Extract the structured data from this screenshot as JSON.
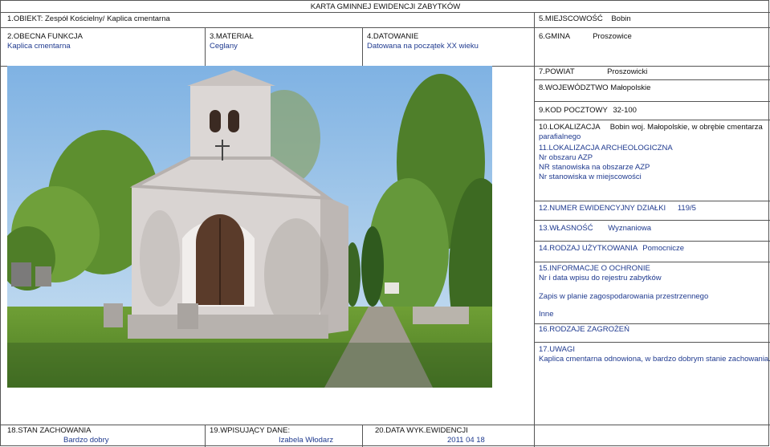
{
  "header": {
    "title": "KARTA GMINNEJ EWIDENCJI ZABYTKÓW"
  },
  "obiekt": {
    "label": "1.OBIEKT:",
    "value": "Zespół Kościelny/ Kaplica cmentarna"
  },
  "miejscowosc": {
    "label": "5.MIEJSCOWOŚĆ",
    "value": "Bobin"
  },
  "funkcja": {
    "label": "2.OBECNA FUNKCJA",
    "value": "Kaplica cmentarna"
  },
  "material": {
    "label": "3.MATERIAŁ",
    "value": "Ceglany"
  },
  "datowanie": {
    "label": "4.DATOWANIE",
    "value": "Datowana na początek XX wieku"
  },
  "gmina": {
    "label": "6.GMINA",
    "value": "Proszowice"
  },
  "powiat": {
    "label": "7.POWIAT",
    "value": "Proszowicki"
  },
  "wojewodztwo": {
    "label": "8.WOJEWÓDZTWO",
    "value": "Małopolskie"
  },
  "kod": {
    "label": "9.KOD POCZTOWY",
    "value": "32-100"
  },
  "lokalizacja": {
    "label": "10.LOKALIZACJA",
    "value_line1": "Bobin woj. Małopolskie, w obrębie cmentarza",
    "value_line2": "parafialnego"
  },
  "archeo": {
    "label": "11.LOKALIZACJA ARCHEOLOGICZNA",
    "lines": [
      "Nr obszaru AZP",
      "NR stanowiska na obszarze  AZP",
      "Nr stanowiska  w  miejscowości"
    ]
  },
  "dzialka": {
    "label": "12.NUMER EWIDENCYJNY DZIAŁKI",
    "value": "119/5"
  },
  "wlasnosc": {
    "label": "13.WŁASNOŚĆ",
    "value": "Wyznaniowa"
  },
  "uzytkowanie": {
    "label": "14.RODZAJ UŻYTKOWANIA",
    "value": "Pomocnicze"
  },
  "ochrona": {
    "label": "15.INFORMACJE O OCHRONIE",
    "line1": "Nr i data wpisu do rejestru zabytków",
    "line2": "Zapis w planie zagospodarowania przestrzennego",
    "line3": "Inne"
  },
  "zagrozenia": {
    "label": "16.RODZAJE ZAGROŻEŃ"
  },
  "uwagi": {
    "label": "17.UWAGI",
    "value": "Kaplica  cmentarna odnowiona, w bardzo dobrym stanie zachowania."
  },
  "stan": {
    "label": "18.STAN ZACHOWANIA",
    "value": "Bardzo dobry"
  },
  "wpisujacy": {
    "label": "19.WPISUJĄCY DANE:",
    "value": "Izabela  Włodarz"
  },
  "data_wyk": {
    "label": "20.DATA WYK.EWIDENCJI",
    "value": "2011 04 18"
  },
  "colors": {
    "text": "#1f3a8f",
    "border": "#555555",
    "sky": "#9fc7ea",
    "wall": "#d9d4d2",
    "grass": "#5c8f2e"
  }
}
